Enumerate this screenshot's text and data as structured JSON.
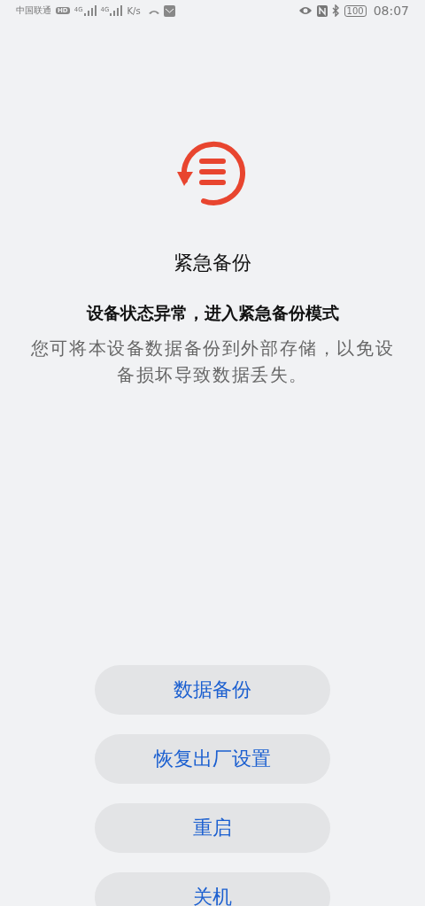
{
  "status_bar": {
    "carrier": "中国联通",
    "hd_badge": "HD",
    "network_labels": [
      "4G",
      "4G"
    ],
    "speed_unit": "K/s",
    "battery": "100",
    "time": "08:07"
  },
  "title": "紧急备份",
  "subtitle": "设备状态异常，进入紧急备份模式",
  "description": "您可将本设备数据备份到外部存储，以免设备损坏导致数据丢失。",
  "buttons": [
    {
      "label": "数据备份"
    },
    {
      "label": "恢复出厂设置"
    },
    {
      "label": "重启"
    },
    {
      "label": "关机"
    }
  ]
}
